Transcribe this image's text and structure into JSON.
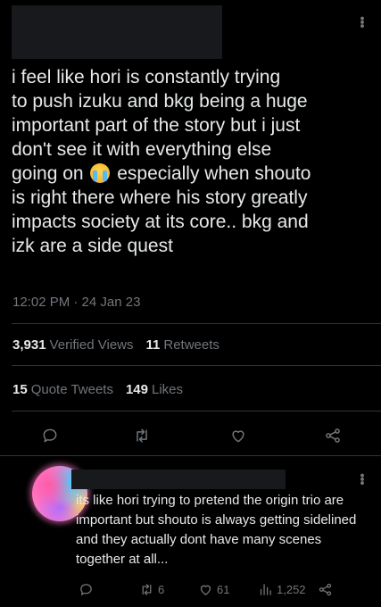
{
  "tweet": {
    "text_before_emoji": "i feel like hori is constantly trying\nto push izuku and bkg being a huge\nimportant part of the story but i just\ndon't see it with everything else\ngoing on",
    "text_after_emoji": " especially when shouto\nis right there where his story greatly\nimpacts society at its core.. bkg and\nizk are a side quest",
    "emoji": "loudly-crying-face",
    "timestamp": "12:02 PM · 24 Jan 23",
    "views_count": "3,931",
    "views_label": "Verified Views",
    "retweets_count": "11",
    "retweets_label": "Retweets",
    "quotes_count": "15",
    "quotes_label": "Quote Tweets",
    "likes_count": "149",
    "likes_label": "Likes",
    "actions": [
      "reply-icon",
      "retweet-icon",
      "like-icon",
      "share-icon"
    ]
  },
  "reply": {
    "text": "its like hori trying to pretend the origin trio are important but shouto is always getting sidelined and they actually dont have many scenes together at all...",
    "retweets": "6",
    "likes": "61",
    "views": "1,252"
  },
  "colors": {
    "background": "#000000",
    "text": "#e7e9ea",
    "secondary": "#71767b",
    "divider": "#2f3336"
  }
}
